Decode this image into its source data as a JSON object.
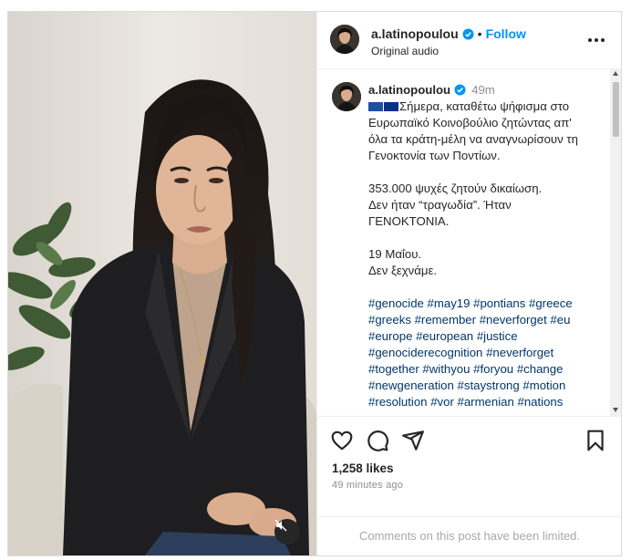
{
  "header": {
    "username": "a.latinopoulou",
    "separator": "•",
    "follow_label": "Follow",
    "audio_label": "Original audio",
    "verified_icon": "verified-badge-icon",
    "more_icon": "more-options-icon"
  },
  "caption": {
    "username": "a.latinopoulou",
    "time": "49m",
    "flags": [
      "greece-flag",
      "eu-flag"
    ],
    "line1": "Σήμερα, καταθέτω ψήφισμα στο Ευρωπαϊκό Κοινοβούλιο ζητώντας απ' όλα τα κράτη-μέλη να αναγνωρίσουν τη Γενοκτονία των Ποντίων.",
    "para2_line1": "353.000 ψυχές ζητούν δικαίωση.",
    "para2_line2": "Δεν ήταν “τραγωδία”. Ήταν ΓΕΝΟΚΤΟΝΙΑ.",
    "para3_line1": "19 Μαΐου.",
    "para3_line2": "Δεν ξεχνάμε.",
    "hashtags": [
      "#genocide",
      "#may19",
      "#pontians",
      "#greece",
      "#greeks",
      "#remember",
      "#neverforget",
      "#eu",
      "#europe",
      "#european",
      "#justice",
      "#genociderecognition",
      "#neverforget",
      "#together",
      "#withyou",
      "#foryou",
      "#change",
      "#newgeneration",
      "#staystrong",
      "#motion",
      "#resolution",
      "#vor",
      "#armenian",
      "#nations"
    ]
  },
  "actions": {
    "like_icon": "heart-icon",
    "comment_icon": "comment-icon",
    "share_icon": "share-icon",
    "save_icon": "bookmark-icon",
    "likes": "1,258 likes",
    "time_ago": "49 minutes ago"
  },
  "comments_notice": "Comments on this post have been limited.",
  "media": {
    "mute_icon": "muted-speaker-icon"
  },
  "colors": {
    "accent": "#0095f6",
    "text": "#262626",
    "muted": "#8e8e8e",
    "hashtag": "#00376b"
  }
}
